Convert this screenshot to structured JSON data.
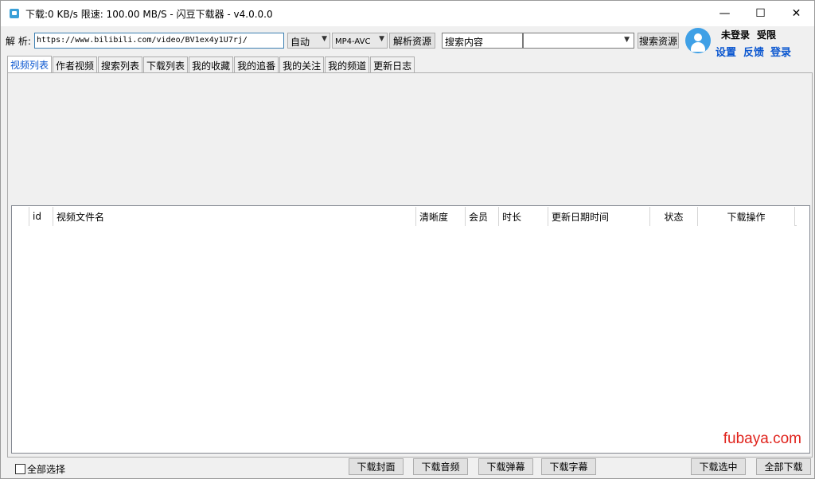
{
  "window": {
    "title": "下载:0 KB/s  限速: 100.00 MB/S  - 闪豆下载器 - v4.0.0.0",
    "controls": {
      "minimize": "—",
      "maximize": "☐",
      "close": "✕"
    }
  },
  "toolbar": {
    "parse_label": "解 析:",
    "url_value": "https://www.bilibili.com/video/BV1ex4y1U7rj/",
    "quality_select": "自动",
    "format_select": "MP4-AVC",
    "parse_button": "解析资源",
    "search_value": "搜索内容",
    "search_combo_value": "",
    "search_button": "搜索资源"
  },
  "user": {
    "login_status": "未登录",
    "limit_status": "受限",
    "links": [
      "设置",
      "反馈",
      "登录"
    ]
  },
  "tabs": [
    "视频列表",
    "作者视频",
    "搜索列表",
    "下载列表",
    "我的收藏",
    "我的追番",
    "我的关注",
    "我的频道",
    "更新日志"
  ],
  "table": {
    "columns": [
      "",
      "id",
      "视频文件名",
      "清晰度",
      "会员",
      "时长",
      "更新日期时间",
      "状态",
      "下载操作"
    ],
    "rows": []
  },
  "watermark": "fubaya.com",
  "bottom": {
    "select_all": "全部选择",
    "buttons": [
      "下载封面",
      "下载音频",
      "下载弹幕",
      "下载字幕"
    ],
    "download_selected": "下载选中",
    "download_all": "全部下载"
  },
  "colors": {
    "accent": "#0b57d0",
    "avatar": "#3fa0e6",
    "watermark": "#e0231c"
  },
  "icons": {
    "app": "app-logo-icon",
    "avatar": "user-avatar-icon",
    "dropdown": "chevron-down-icon"
  }
}
